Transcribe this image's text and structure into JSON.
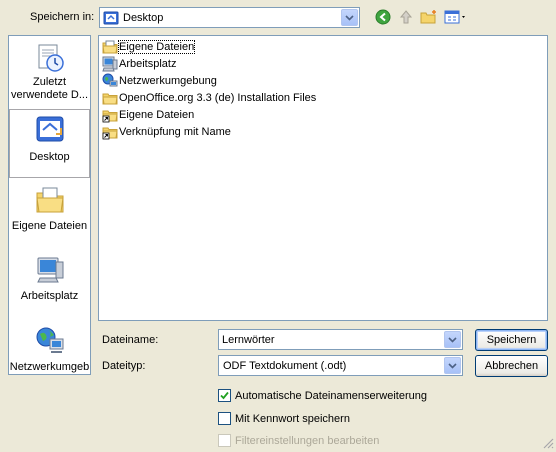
{
  "toolbar": {
    "save_in_label": "Speichern in:",
    "location": "Desktop",
    "icons": [
      "back-icon",
      "up-folder-icon",
      "new-folder-icon",
      "view-menu-icon"
    ]
  },
  "places": [
    {
      "label_line1": "Zuletzt",
      "label_line2": "verwendete D...",
      "icon": "recent-documents-icon"
    },
    {
      "label_line1": "Desktop",
      "label_line2": "",
      "icon": "desktop-icon"
    },
    {
      "label_line1": "Eigene Dateien",
      "label_line2": "",
      "icon": "my-documents-icon"
    },
    {
      "label_line1": "Arbeitsplatz",
      "label_line2": "",
      "icon": "my-computer-icon"
    },
    {
      "label_line1": "Netzwerkumgeb",
      "label_line2": "",
      "icon": "network-icon"
    }
  ],
  "files": [
    {
      "name": "Eigene Dateien",
      "icon": "folder-icon"
    },
    {
      "name": "Arbeitsplatz",
      "icon": "computer-icon"
    },
    {
      "name": "Netzwerkumgebung",
      "icon": "network-icon"
    },
    {
      "name": "OpenOffice.org 3.3 (de) Installation Files",
      "icon": "folder-icon"
    },
    {
      "name": "Eigene Dateien",
      "icon": "shortcut-icon"
    },
    {
      "name": "Verknüpfung mit Name",
      "icon": "shortcut-icon"
    }
  ],
  "form": {
    "filename_label": "Dateiname:",
    "filename_value": "Lernwörter",
    "filetype_label": "Dateityp:",
    "filetype_value": "ODF Textdokument (.odt)"
  },
  "buttons": {
    "save": "Speichern",
    "cancel": "Abbrechen"
  },
  "options": {
    "auto_extension": {
      "label": "Automatische Dateinamenserweiterung",
      "checked": true,
      "enabled": true
    },
    "password": {
      "label": "Mit Kennwort speichern",
      "checked": false,
      "enabled": true
    },
    "filter_settings": {
      "label": "Filtereinstellungen bearbeiten",
      "checked": false,
      "enabled": false
    }
  },
  "colors": {
    "dialog_bg": "#ECE9D8",
    "border": "#7F9DB9",
    "folder_yellow": "#F5D46B",
    "accent_blue": "#316AC5"
  }
}
